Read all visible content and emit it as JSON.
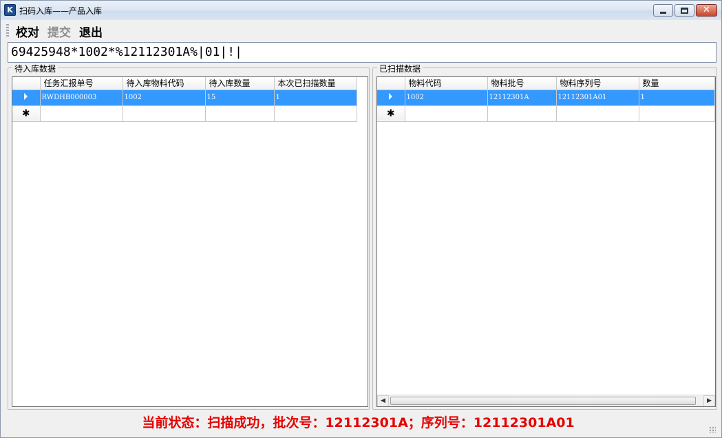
{
  "window": {
    "title": "扫码入库——产品入库",
    "icon_label": "K",
    "controls": [
      "minimize-icon",
      "maximize-icon",
      "close-icon"
    ]
  },
  "toolbar": {
    "check_label": "校对",
    "submit_label": "提交",
    "exit_label": "退出"
  },
  "scan": {
    "value": "69425948*1002*%12112301A%|01|!|"
  },
  "pending": {
    "group_label": "待入库数据",
    "columns": [
      "任务汇报单号",
      "待入库物料代码",
      "待入库数量",
      "本次已扫描数量"
    ],
    "rows": [
      [
        "RWDHB000003",
        "1002",
        "15",
        "1"
      ]
    ]
  },
  "scanned": {
    "group_label": "已扫描数据",
    "columns": [
      "物料代码",
      "物料批号",
      "物料序列号",
      "数量"
    ],
    "rows": [
      [
        "1002",
        "12112301A",
        "12112301A01",
        "1"
      ]
    ]
  },
  "status": {
    "text": "当前状态：扫描成功，批次号：12112301A；序列号：12112301A01",
    "color": "#e60000"
  },
  "colors": {
    "selection": "#3399ff",
    "titlebar": "#dde8f4"
  }
}
